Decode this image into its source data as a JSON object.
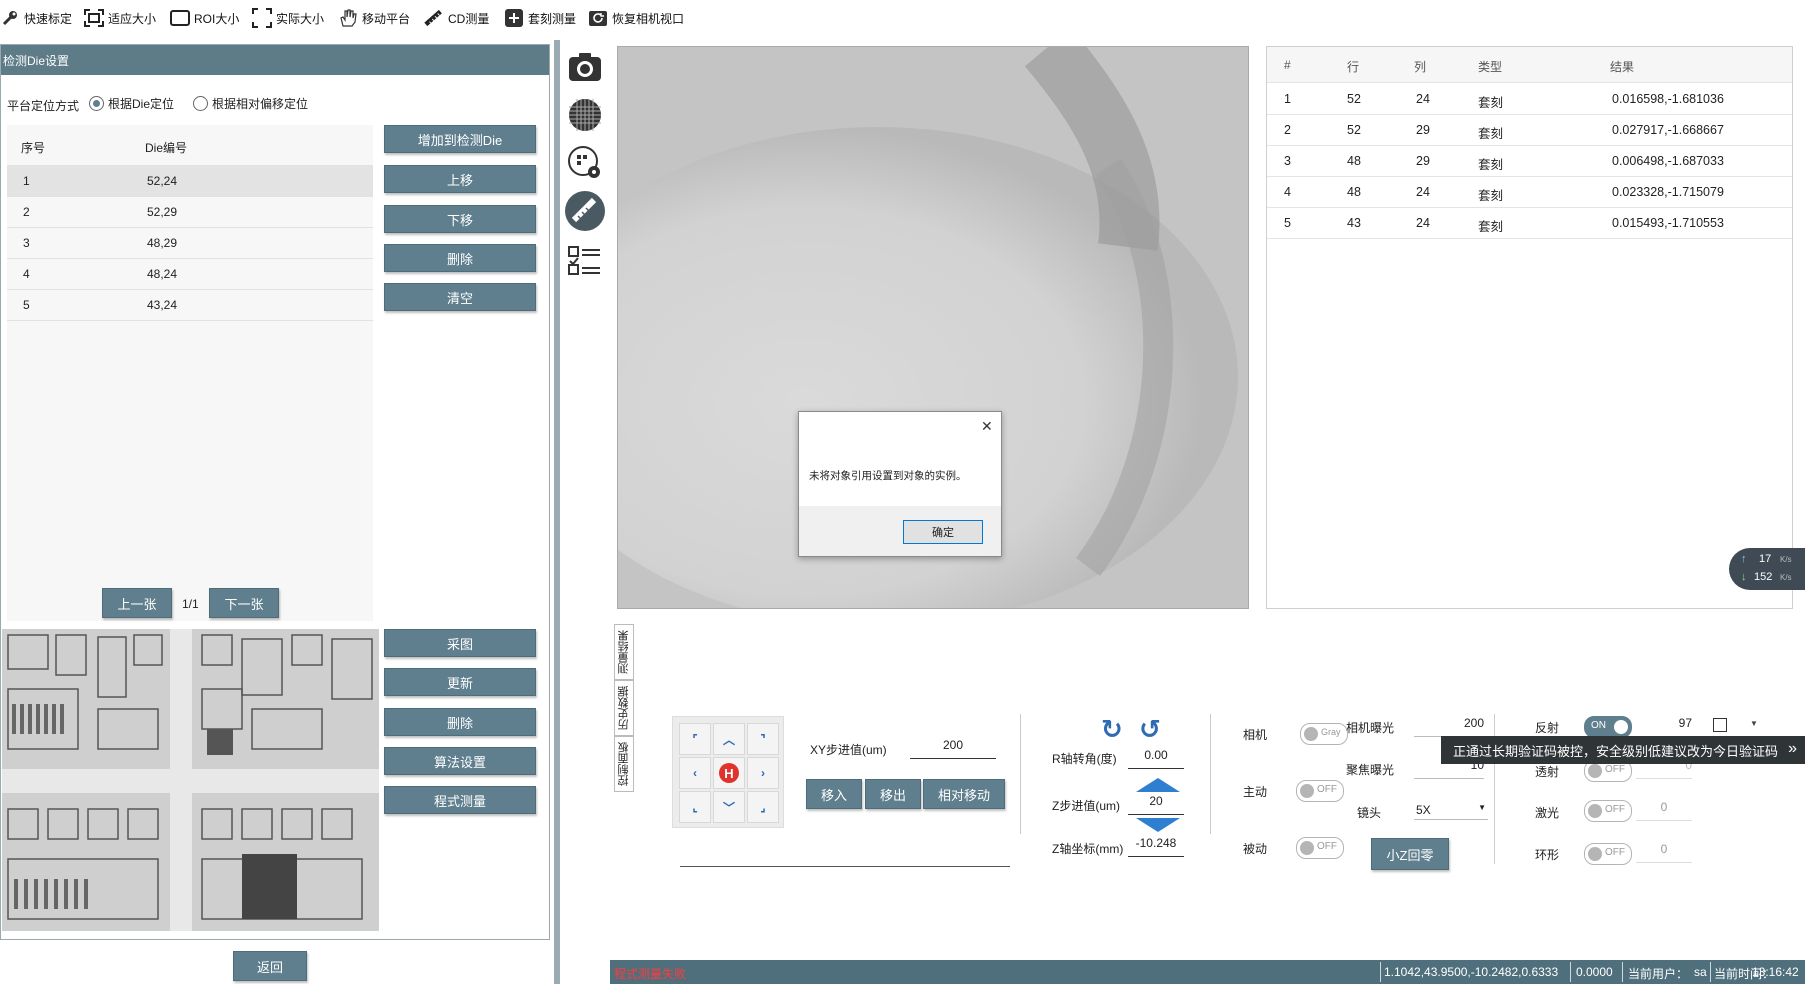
{
  "toolbar": {
    "items": [
      {
        "label": "快速标定",
        "icon": "wrench-icon"
      },
      {
        "label": "适应大小",
        "icon": "fit-icon"
      },
      {
        "label": "ROI大小",
        "icon": "roi-icon"
      },
      {
        "label": "实际大小",
        "icon": "actual-size-icon"
      },
      {
        "label": "移动平台",
        "icon": "hand-icon"
      },
      {
        "label": "CD测量",
        "icon": "ruler-icon"
      },
      {
        "label": "套刻测量",
        "icon": "plus-square-icon"
      },
      {
        "label": "恢复相机视口",
        "icon": "refresh-camera-icon"
      }
    ]
  },
  "left_panel": {
    "title": "检测Die设置",
    "positioning_label": "平台定位方式",
    "radio_die": "根据Die定位",
    "radio_offset": "根据相对偏移定位",
    "selected_radio": "根据Die定位",
    "table": {
      "headers": [
        "序号",
        "Die编号"
      ],
      "rows": [
        {
          "index": "1",
          "die": "52,24"
        },
        {
          "index": "2",
          "die": "52,29"
        },
        {
          "index": "3",
          "die": "48,29"
        },
        {
          "index": "4",
          "die": "48,24"
        },
        {
          "index": "5",
          "die": "43,24"
        }
      ]
    },
    "buttons": {
      "add": "增加到检测Die",
      "up": "上移",
      "down": "下移",
      "delete": "删除",
      "clear": "清空"
    },
    "pager": {
      "prev": "上一张",
      "page": "1/1",
      "next": "下一张"
    },
    "image_buttons": {
      "capture": "采图",
      "update": "更新",
      "delete": "删除",
      "algo": "算法设置",
      "program": "程式测量"
    },
    "back": "返回"
  },
  "results": {
    "headers": [
      "#",
      "行",
      "列",
      "类型",
      "结果"
    ],
    "rows": [
      {
        "n": "1",
        "row": "52",
        "col": "24",
        "type": "套刻",
        "result": "0.016598,-1.681036"
      },
      {
        "n": "2",
        "row": "52",
        "col": "29",
        "type": "套刻",
        "result": "0.027917,-1.668667"
      },
      {
        "n": "3",
        "row": "48",
        "col": "29",
        "type": "套刻",
        "result": "0.006498,-1.687033"
      },
      {
        "n": "4",
        "row": "48",
        "col": "24",
        "type": "套刻",
        "result": "0.023328,-1.715079"
      },
      {
        "n": "5",
        "row": "43",
        "col": "24",
        "type": "套刻",
        "result": "0.015493,-1.710553"
      }
    ]
  },
  "dialog": {
    "message": "未将对象引用设置到对象的实例。",
    "ok": "确定"
  },
  "net_speed": {
    "up": "17",
    "up_unit": "K/s",
    "down": "152",
    "down_unit": "K/s"
  },
  "vertical_tabs": [
    "测量结果",
    "历史数据",
    "控制面板"
  ],
  "control": {
    "xy_step_label": "XY步进值(um)",
    "xy_step_value": "200",
    "move_in": "移入",
    "move_out": "移出",
    "relative_move": "相对移动",
    "home_label": "H",
    "r_label": "R轴转角(度)",
    "r_value": "0.00",
    "z_step_label": "Z步进值(um)",
    "z_step_value": "20",
    "z_coord_label": "Z轴坐标(mm)",
    "z_coord_value": "-10.248",
    "camera_label": "相机",
    "camera_toggle": "Gray",
    "active_label": "主动",
    "active_toggle": "OFF",
    "passive_label": "被动",
    "passive_toggle": "OFF",
    "cam_exposure_label": "相机曝光",
    "cam_exposure_value": "200",
    "focus_exposure_label": "聚焦曝光",
    "focus_exposure_value": "10",
    "lens_label": "镜头",
    "lens_value": "5X",
    "small_z_zero": "小Z回零",
    "reflect_label": "反射",
    "reflect_toggle": "ON",
    "reflect_value": "97",
    "transmit_label": "透射",
    "transmit_toggle": "OFF",
    "transmit_value": "0",
    "laser_label": "激光",
    "laser_toggle": "OFF",
    "laser_value": "0",
    "ring_label": "环形",
    "ring_toggle": "OFF",
    "ring_value": "0"
  },
  "tooltip": "正通过长期验证码被控，安全级别低建议改为今日验证码",
  "status_bar": {
    "error": "程式测量失败",
    "coords": "1.1042,43.9500,-10.2482,0.6333",
    "value": "0.0000",
    "user_label": "当前用户：",
    "user": "sa",
    "time_label": "当前时间：",
    "time": "13:16:42"
  },
  "colors": {
    "accent": "#5f7f8e",
    "status_bar": "#4f6f7c",
    "error_text": "#ff3b3b",
    "toggle_on": "#5f7f8e"
  }
}
